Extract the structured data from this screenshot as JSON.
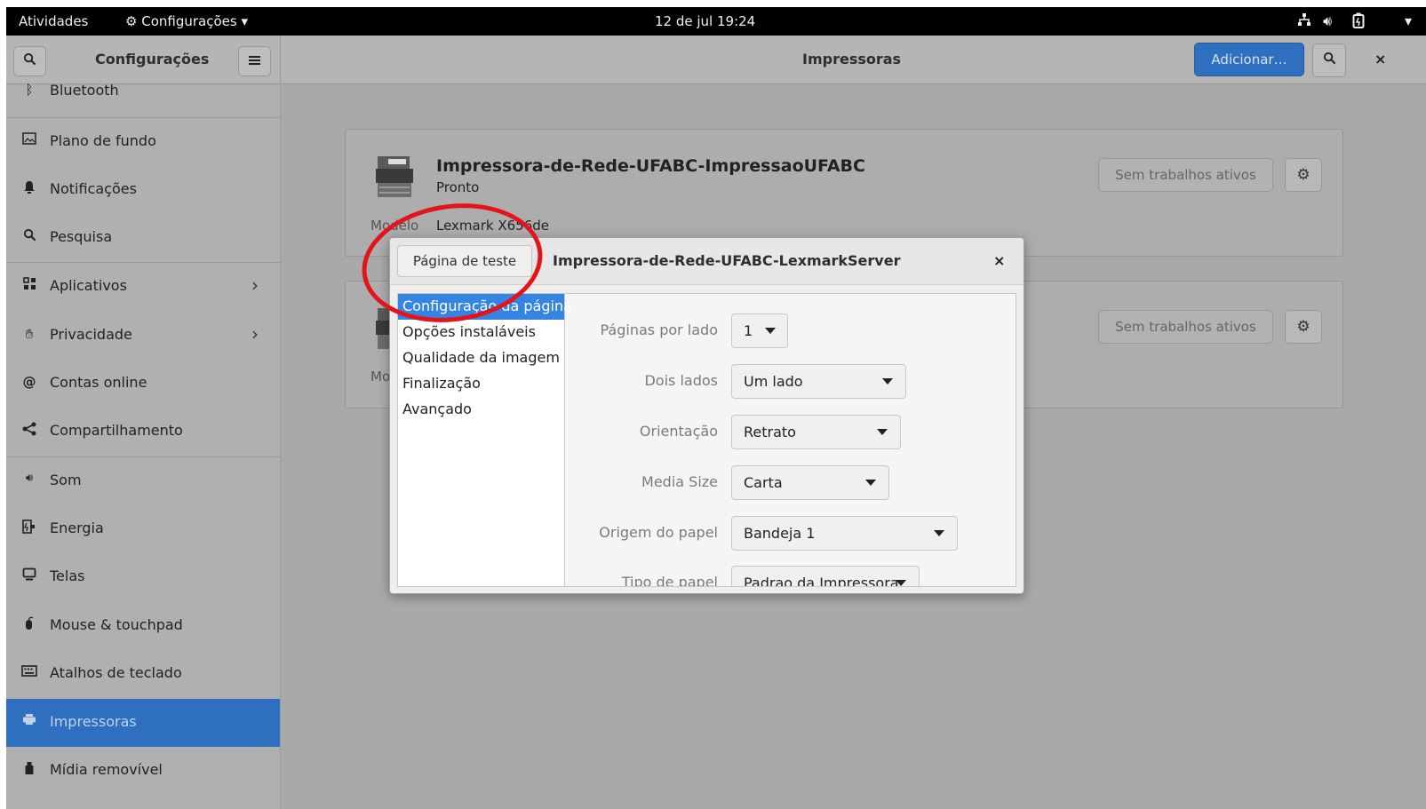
{
  "topbar": {
    "activities": "Atividades",
    "app_menu": "Configurações",
    "clock": "12 de jul 19:24"
  },
  "header": {
    "sidebar_title": "Configurações",
    "main_title": "Impressoras",
    "add_button": "Adicionar…",
    "close": "×"
  },
  "sidebar": {
    "items": [
      {
        "label": "Bluetooth"
      },
      {
        "label": "Plano de fundo"
      },
      {
        "label": "Notificações"
      },
      {
        "label": "Pesquisa"
      },
      {
        "label": "Aplicativos"
      },
      {
        "label": "Privacidade"
      },
      {
        "label": "Contas online"
      },
      {
        "label": "Compartilhamento"
      },
      {
        "label": "Som"
      },
      {
        "label": "Energia"
      },
      {
        "label": "Telas"
      },
      {
        "label": "Mouse & touchpad"
      },
      {
        "label": "Atalhos de teclado"
      },
      {
        "label": "Impressoras"
      },
      {
        "label": "Mídia removível"
      }
    ]
  },
  "printers": [
    {
      "name": "Impressora-de-Rede-UFABC-ImpressaoUFABC",
      "status": "Pronto",
      "model_label": "Modelo",
      "model": "Lexmark X656de",
      "jobs": "Sem trabalhos ativos"
    },
    {
      "model_label": "Mo",
      "jobs": "Sem trabalhos ativos"
    }
  ],
  "dialog": {
    "test_page_button": "Página de teste",
    "title": "Impressora-de-Rede-UFABC-LexmarkServer",
    "close": "×",
    "sections": [
      "Configuração da página",
      "Opções instaláveis",
      "Qualidade da imagem",
      "Finalização",
      "Avançado"
    ],
    "selected_section": "Configuração da página",
    "fields": [
      {
        "label": "Páginas por lado",
        "value": "1"
      },
      {
        "label": "Dois lados",
        "value": "Um lado"
      },
      {
        "label": "Orientação",
        "value": "Retrato"
      },
      {
        "label": "Media Size",
        "value": "Carta"
      },
      {
        "label": "Origem do papel",
        "value": "Bandeja 1"
      },
      {
        "label": "Tipo de papel",
        "value": "Padrao da Impressora"
      }
    ]
  },
  "annotation": {
    "color": "#e3141b",
    "target": "test_page_button"
  }
}
